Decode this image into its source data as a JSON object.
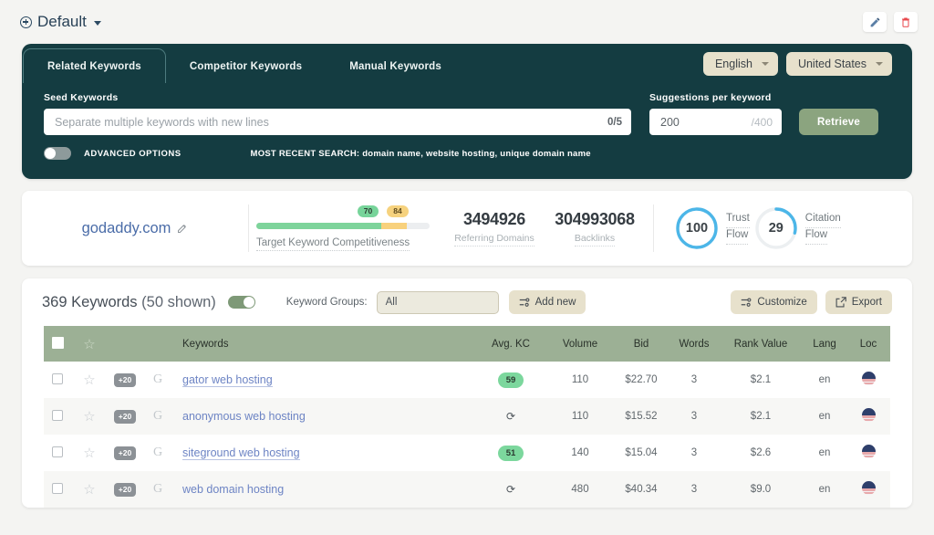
{
  "topbar": {
    "preset_label": "Default",
    "edit_icon": "pencil-icon",
    "delete_icon": "trash-icon"
  },
  "search_panel": {
    "tabs": [
      {
        "label": "Related Keywords",
        "active": true
      },
      {
        "label": "Competitor Keywords",
        "active": false
      },
      {
        "label": "Manual Keywords",
        "active": false
      }
    ],
    "language_select": "English",
    "country_select": "United States",
    "seed": {
      "label": "Seed Keywords",
      "placeholder": "Separate multiple keywords with new lines",
      "value": "",
      "counter": "0/5"
    },
    "suggestions": {
      "label": "Suggestions per keyword",
      "value": "200",
      "max": "/400"
    },
    "retrieve_label": "Retrieve",
    "advanced_options_label": "ADVANCED OPTIONS",
    "advanced_options_on": false,
    "recent_search": "MOST RECENT SEARCH: domain name, website hosting, unique domain name"
  },
  "stats": {
    "domain": "godaddy.com",
    "domain_edit_icon": "pencil-icon",
    "competitiveness": {
      "caption": "Target Keyword Competitiveness",
      "badge_green": "70",
      "badge_yellow": "84",
      "green_pct": 72,
      "yellow_pct": 15,
      "accent_green": "#7ed49b",
      "accent_yellow": "#f8d17c"
    },
    "numbers": [
      {
        "value": "3494926",
        "caption": "Referring Domains"
      },
      {
        "value": "304993068",
        "caption": "Backlinks"
      }
    ],
    "flows": [
      {
        "value": "100",
        "label_line1": "Trust",
        "label_line2": "Flow",
        "pct": 100,
        "color": "#4cb6e8"
      },
      {
        "value": "29",
        "label_line1": "Citation",
        "label_line2": "Flow",
        "pct": 29,
        "color": "#4cb6e8"
      }
    ]
  },
  "keywords_panel": {
    "title_count": "369 Keywords",
    "title_shown": "(50 shown)",
    "toggle_on": true,
    "groups_label": "Keyword Groups:",
    "groups_value": "All",
    "add_new_label": "Add new",
    "customize_label": "Customize",
    "export_label": "Export",
    "columns": [
      "",
      "",
      "",
      "",
      "Keywords",
      "Avg. KC",
      "Volume",
      "Bid",
      "Words",
      "Rank Value",
      "Lang",
      "Loc"
    ],
    "rows": [
      {
        "badge": "+20",
        "keyword": "gator web hosting",
        "kc": "59",
        "kc_type": "pill",
        "volume": "110",
        "bid": "$22.70",
        "words": "3",
        "rank_value": "$2.1",
        "lang": "en",
        "loc": "us-flag-icon"
      },
      {
        "badge": "+20",
        "keyword": "anonymous web hosting",
        "kc": "",
        "kc_type": "refresh",
        "volume": "110",
        "bid": "$15.52",
        "words": "3",
        "rank_value": "$2.1",
        "lang": "en",
        "loc": "us-flag-icon"
      },
      {
        "badge": "+20",
        "keyword": "siteground web hosting",
        "kc": "51",
        "kc_type": "pill",
        "volume": "140",
        "bid": "$15.04",
        "words": "3",
        "rank_value": "$2.6",
        "lang": "en",
        "loc": "us-flag-icon"
      },
      {
        "badge": "+20",
        "keyword": "web domain hosting",
        "kc": "",
        "kc_type": "refresh",
        "volume": "480",
        "bid": "$40.34",
        "words": "3",
        "rank_value": "$9.0",
        "lang": "en",
        "loc": "us-flag-icon"
      }
    ]
  },
  "theme": {
    "panel_dark": "#143c41",
    "accent_sage": "#8ba47f",
    "table_header": "#9cb095",
    "pill_beige": "#e7e1cc",
    "link_blue": "#6d84c4"
  }
}
